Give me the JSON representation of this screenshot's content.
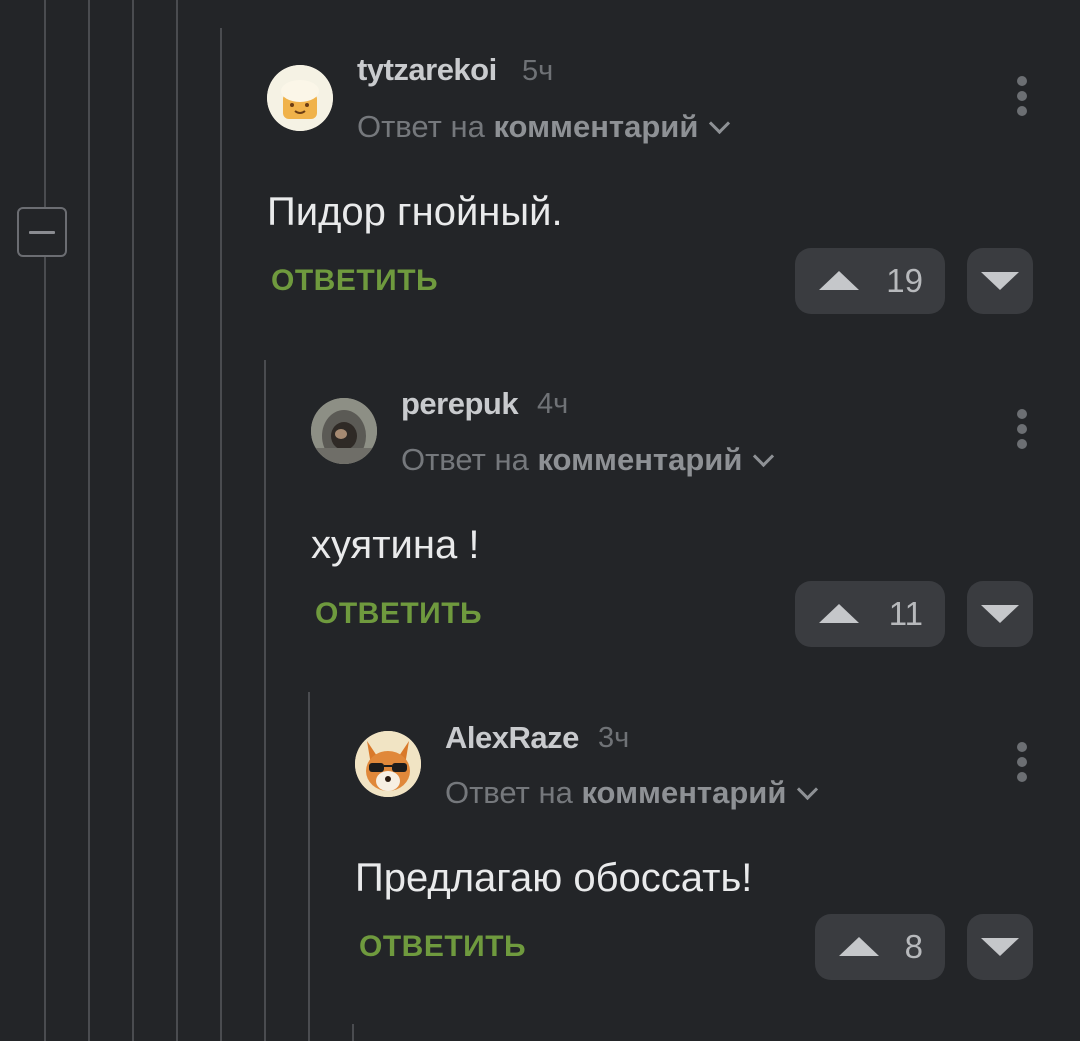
{
  "thread": {
    "comments": [
      {
        "username": "tytzarekoi",
        "time": "5ч",
        "reply_prefix": "Ответ на",
        "reply_target": "комментарий",
        "text": "Пидор гнойный.",
        "reply_label": "ОТВЕТИТЬ",
        "votes": "19",
        "avatar": "cookie-chef-avatar"
      },
      {
        "username": "perepuk",
        "time": "4ч",
        "reply_prefix": "Ответ на",
        "reply_target": "комментарий",
        "text": "хуятина !",
        "reply_label": "ОТВЕТИТЬ",
        "votes": "11",
        "avatar": "hooded-photo-avatar"
      },
      {
        "username": "AlexRaze",
        "time": "3ч",
        "reply_prefix": "Ответ на",
        "reply_target": "комментарий",
        "text": "Предлагаю обоссать!",
        "reply_label": "ОТВЕТИТЬ",
        "votes": "8",
        "avatar": "fox-sunglasses-avatar"
      }
    ]
  },
  "colors": {
    "background": "#232528",
    "reply_link": "#6f9a3e",
    "vote_button": "#3a3c40",
    "thread_line": "#4a4c50"
  }
}
